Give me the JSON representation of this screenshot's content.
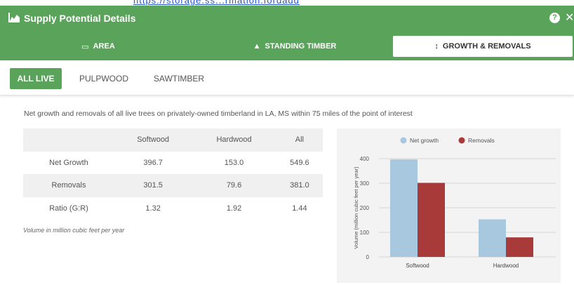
{
  "header": {
    "url_fragment": "https://storage.ss...rmation.fordadd",
    "title": "Supply Potential Details",
    "help_label": "?",
    "close_label": "✕"
  },
  "tabs": [
    {
      "label": "AREA",
      "icon": "map-icon",
      "active": false
    },
    {
      "label": "STANDING TIMBER",
      "icon": "tree-icon",
      "active": false
    },
    {
      "label": "GROWTH & REMOVALS",
      "icon": "up-down-arrow-icon",
      "active": true
    }
  ],
  "subtabs": [
    {
      "label": "ALL LIVE",
      "active": true
    },
    {
      "label": "PULPWOOD",
      "active": false
    },
    {
      "label": "SAWTIMBER",
      "active": false
    }
  ],
  "description": "Net growth and removals of all live trees on privately-owned timberland in LA, MS within 75 miles of the point of interest",
  "table": {
    "columns": [
      "",
      "Softwood",
      "Hardwood",
      "All"
    ],
    "rows": [
      {
        "label": "Net Growth",
        "values": [
          "396.7",
          "153.0",
          "549.6"
        ]
      },
      {
        "label": "Removals",
        "values": [
          "301.5",
          "79.6",
          "381.0"
        ]
      },
      {
        "label": "Ratio (G:R)",
        "values": [
          "1.32",
          "1.92",
          "1.44"
        ]
      }
    ],
    "note": "Volume in million cubic feet per year"
  },
  "colors": {
    "brand_green": "#5aa35a",
    "net_growth": "#a7c8df",
    "removals": "#a83a3a"
  },
  "chart_data": {
    "type": "bar",
    "categories": [
      "Softwood",
      "Hardwood"
    ],
    "series": [
      {
        "name": "Net growth",
        "values": [
          396.7,
          153.0
        ]
      },
      {
        "name": "Removals",
        "values": [
          301.5,
          79.6
        ]
      }
    ],
    "ylabel": "Volume (million cubic feet per year)",
    "ylim": [
      0,
      400
    ],
    "yticks": [
      "0",
      "100",
      "200",
      "300",
      "400"
    ],
    "legend": "top",
    "grid": true
  }
}
